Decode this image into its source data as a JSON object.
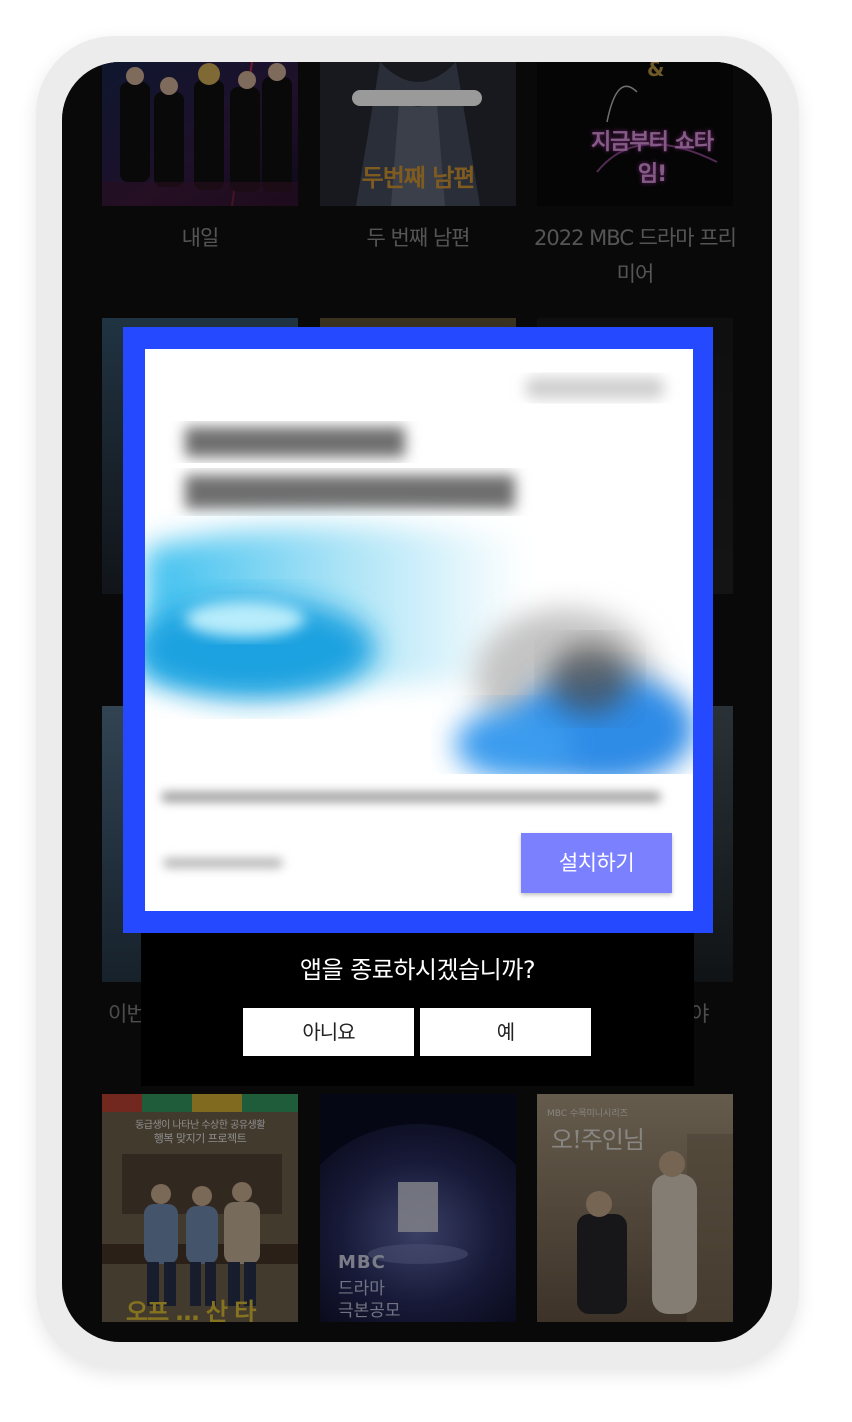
{
  "grid": {
    "row1": [
      {
        "title": "내일",
        "poster_text": ""
      },
      {
        "title": "두 번째 남편",
        "poster_text": "두번째 남편"
      },
      {
        "title": "2022 MBC 드라마 프리미어",
        "poster_text": "지금부터 쇼타임!"
      }
    ],
    "row3_partial_left": "이번",
    "row3_partial_right": "야",
    "row4": [
      {
        "poster_text_top": "동급생이 나타난 수상한 공유생활",
        "poster_text_sub": "행복 맞지기 프로젝트",
        "poster_text_bottom": "오프 … 산 타"
      },
      {
        "poster_text_top": "MBC",
        "poster_text_sub": "드라마",
        "poster_text_bottom": "극본공모"
      },
      {
        "poster_text_top": "오!주인님",
        "poster_text_sub": "MBC 수목미니시리즈",
        "poster_text_bottom": ""
      }
    ]
  },
  "ad": {
    "install_label": "설치하기"
  },
  "exit_dialog": {
    "question": "앱을 종료하시겠습니까?",
    "no_label": "아니요",
    "yes_label": "예"
  },
  "colors": {
    "ad_border": "#2549ff",
    "install_button": "#7b80ff",
    "app_background": "#111111"
  }
}
